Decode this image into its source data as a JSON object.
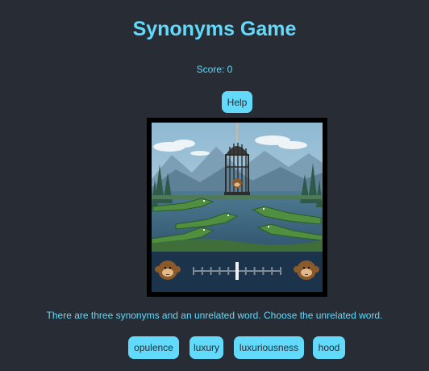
{
  "game": {
    "title": "Synonyms Game",
    "score_text": "Score: 0",
    "help_label": "Help",
    "instruction": "There are three synonyms and an unrelated word. Choose the unrelated word."
  },
  "choices": [
    "opulence",
    "luxury",
    "luxuriousness",
    "hood"
  ],
  "slider": {
    "position_fraction": 0.5
  },
  "colors": {
    "background": "#282c34",
    "accent": "#61dafb",
    "button_text": "#282c34"
  },
  "icons": {
    "cage": "caged-monkey-icon",
    "left_player": "monkey-icon",
    "right_player": "monkey-icon",
    "hazard": "crocodile-icon"
  }
}
